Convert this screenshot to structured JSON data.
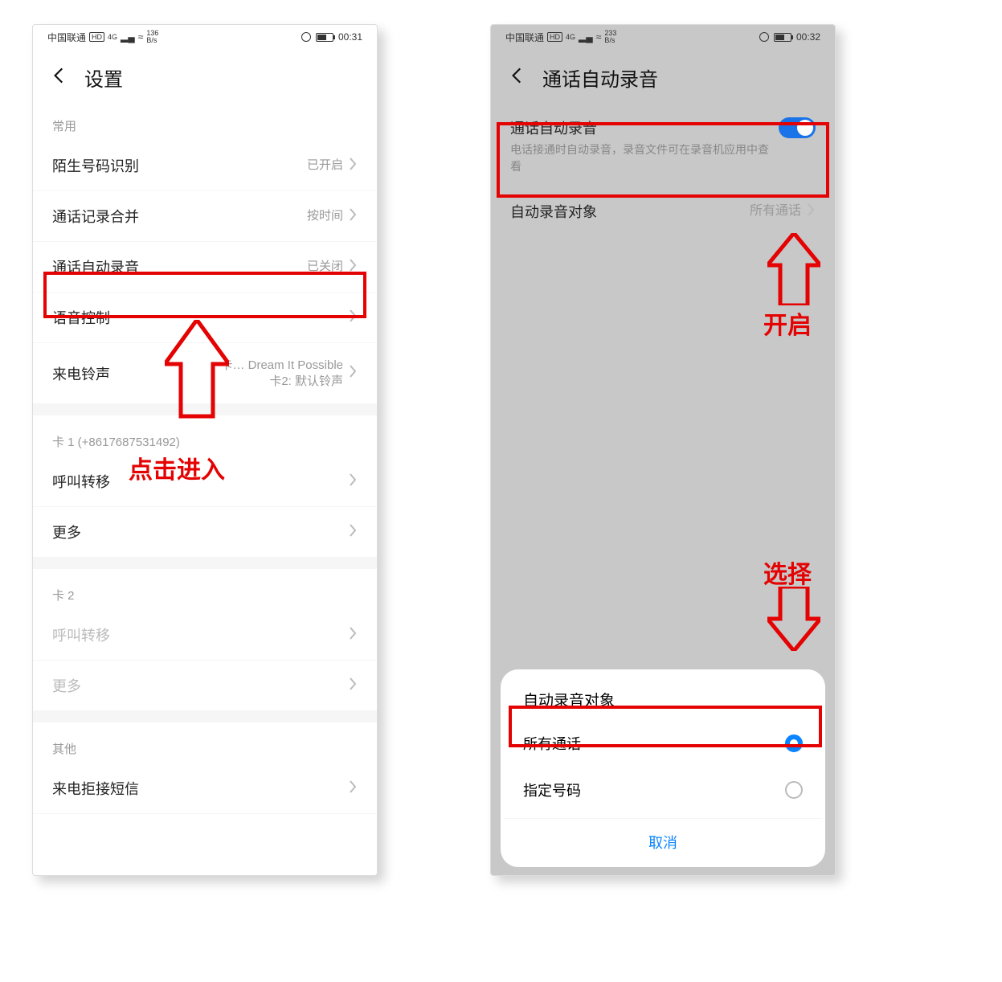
{
  "left": {
    "status": {
      "carrier": "中国联通",
      "hd": "HD",
      "net": "4G",
      "wifi": "≈",
      "rate_top": "136",
      "rate_bot": "B/s",
      "batt": "52",
      "time": "00:31"
    },
    "title": "设置",
    "section_common": "常用",
    "items": [
      {
        "label": "陌生号码识别",
        "value": "已开启"
      },
      {
        "label": "通话记录合并",
        "value": "按时间"
      },
      {
        "label": "通话自动录音",
        "value": "已关闭"
      },
      {
        "label": "语音控制",
        "value": ""
      },
      {
        "label": "来电铃声",
        "value": "卡… Dream It Possible\n卡2: 默认铃声"
      }
    ],
    "sim1_label": "卡 1 (+8617687531492)",
    "sim1_items": [
      {
        "label": "呼叫转移",
        "value": ""
      },
      {
        "label": "更多",
        "value": ""
      }
    ],
    "sim2_label": "卡 2",
    "sim2_items": [
      {
        "label": "呼叫转移",
        "value": ""
      },
      {
        "label": "更多",
        "value": ""
      }
    ],
    "section_other": "其他",
    "other_item": {
      "label": "来电拒接短信",
      "value": ""
    }
  },
  "right": {
    "status": {
      "carrier": "中国联通",
      "hd": "HD",
      "net": "4G",
      "wifi": "≈",
      "rate_top": "233",
      "rate_bot": "B/s",
      "batt": "52",
      "time": "00:32"
    },
    "title": "通话自动录音",
    "row1_title": "通话自动录音",
    "row1_desc": "电话接通时自动录音，录音文件可在录音机应用中查看",
    "row2_label": "自动录音对象",
    "row2_value": "所有通话",
    "sheet_title": "自动录音对象",
    "sheet_opt1": "所有通话",
    "sheet_opt2": "指定号码",
    "sheet_cancel": "取消"
  },
  "annot": {
    "click_enter": "点击进入",
    "enable": "开启",
    "select": "选择"
  }
}
